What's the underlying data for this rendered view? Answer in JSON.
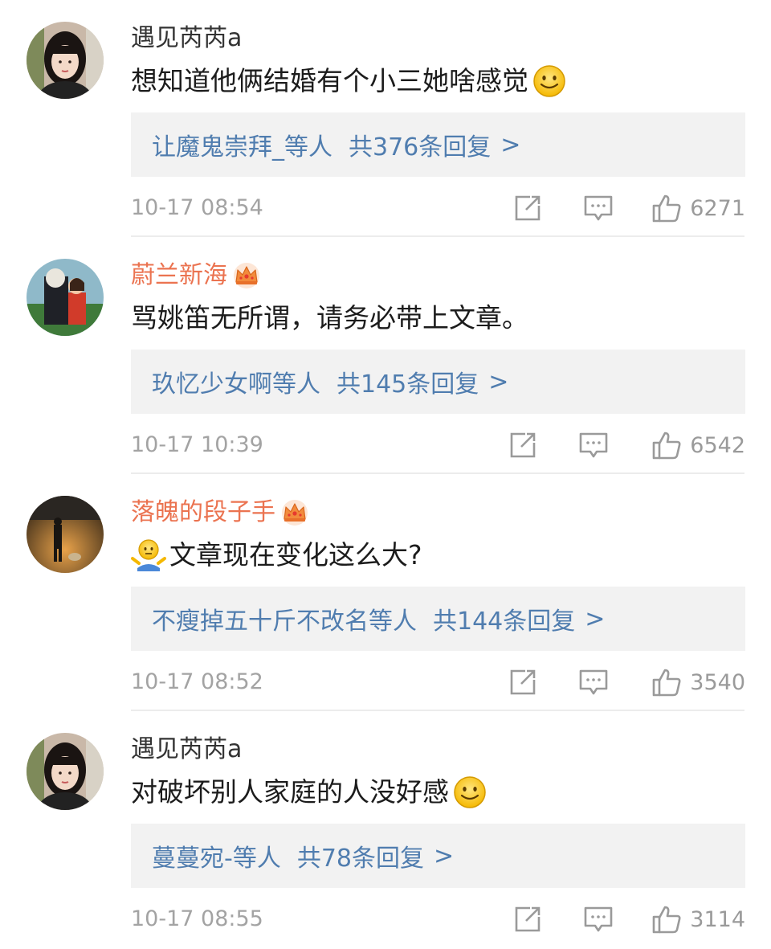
{
  "comments": [
    {
      "username": "遇见芮芮a",
      "vip": false,
      "text": "想知道他俩结婚有个小三她啥感觉",
      "emoji": "smile-emoji-icon",
      "emoji_position": "end",
      "replies_users": "让魔鬼崇拜_等人",
      "replies_count": "共376条回复",
      "replies_chevron": ">",
      "time": "10-17 08:54",
      "likes": "6271"
    },
    {
      "username": "蔚兰新海",
      "vip": true,
      "text": "骂姚笛无所谓，请务必带上文章。",
      "emoji": "",
      "emoji_position": "none",
      "replies_users": "玖忆少女啊等人",
      "replies_count": "共145条回复",
      "replies_chevron": ">",
      "time": "10-17 10:39",
      "likes": "6542"
    },
    {
      "username": "落魄的段子手",
      "vip": true,
      "text": "文章现在变化这么大?",
      "emoji": "shrug-emoji-icon",
      "emoji_position": "start",
      "replies_users": "不瘦掉五十斤不改名等人",
      "replies_count": "共144条回复",
      "replies_chevron": ">",
      "time": "10-17 08:52",
      "likes": "3540"
    },
    {
      "username": "遇见芮芮a",
      "vip": false,
      "text": "对破坏别人家庭的人没好感",
      "emoji": "smile-emoji-icon",
      "emoji_position": "end",
      "replies_users": "蔓蔓宛-等人",
      "replies_count": "共78条回复",
      "replies_chevron": ">",
      "time": "10-17 08:55",
      "likes": "3114"
    }
  ],
  "colors": {
    "vip_name": "#eb7350",
    "link": "#507daf",
    "reply_bg": "#f2f2f2",
    "meta": "#a3a3a3"
  },
  "icons": {
    "share": "share-icon",
    "comment": "comment-icon",
    "like": "thumbs-up-icon",
    "vip": "crown-icon"
  }
}
